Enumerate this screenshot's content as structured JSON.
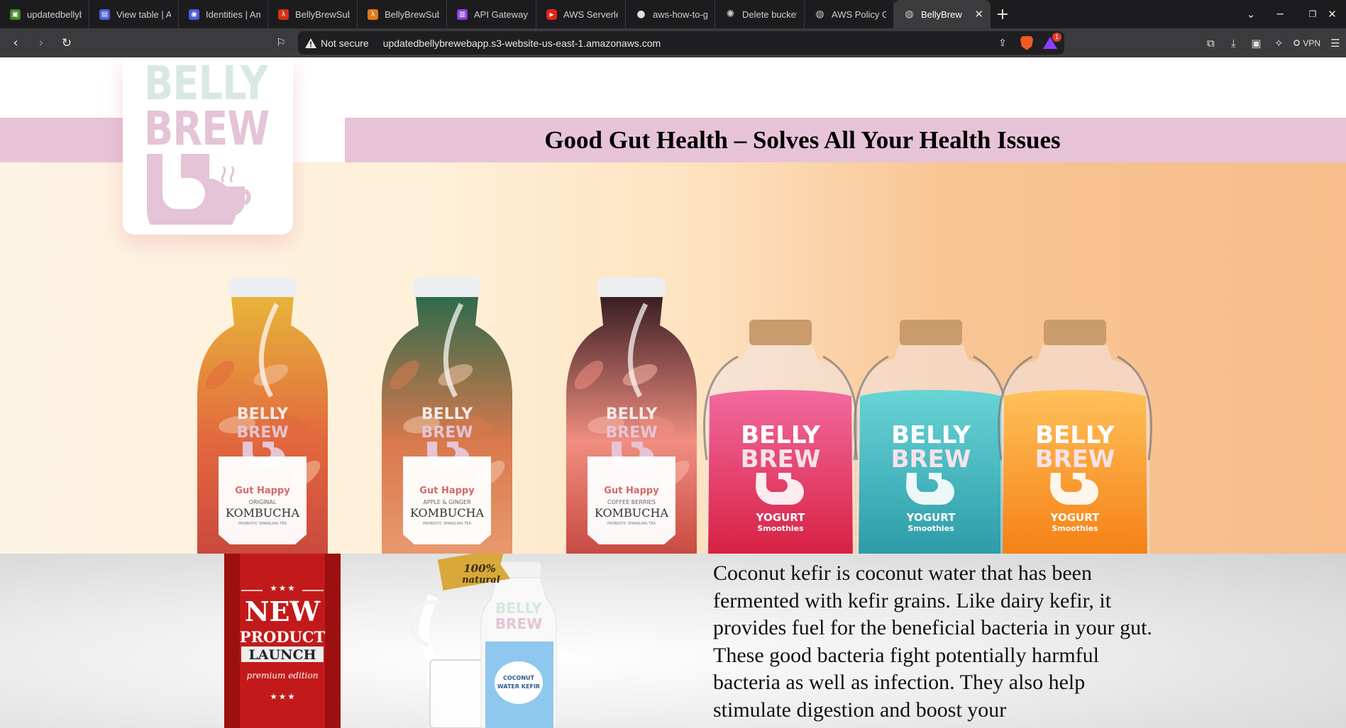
{
  "browser": {
    "tabs": [
      {
        "title": "updatedbellybrewe",
        "icon": "aws-s3-icon",
        "color": "#3f8624"
      },
      {
        "title": "View table | Amazo",
        "icon": "dynamodb-icon",
        "color": "#4d5bdb"
      },
      {
        "title": "Identities | Amazon",
        "icon": "cognito-icon",
        "color": "#4d5bdb"
      },
      {
        "title": "BellyBrewSubmitHa",
        "icon": "lambda-icon",
        "color": "#d13212"
      },
      {
        "title": "BellyBrewSubmitHa",
        "icon": "lambda-icon",
        "color": "#e07b16"
      },
      {
        "title": "API Gateway - API s",
        "icon": "api-gateway-icon",
        "color": "#8b3fd9"
      },
      {
        "title": "AWS Serverless Tut",
        "icon": "youtube-icon",
        "color": "#e62117"
      },
      {
        "title": "aws-how-to-guide/",
        "icon": "github-icon",
        "color": "#e0e0e0"
      },
      {
        "title": "Delete bucket polic",
        "icon": "chatgpt-icon",
        "color": "#cccccc"
      },
      {
        "title": "AWS Policy Generat",
        "icon": "globe-icon",
        "color": "#cccccc"
      },
      {
        "title": "BellyBrew",
        "icon": "globe-icon",
        "color": "#cccccc",
        "active": true
      }
    ],
    "new_tab": "+",
    "security_label": "Not secure",
    "url": "updatedbellybrewebapp.s3-website-us-east-1.amazonaws.com",
    "rewards_badge": "1",
    "vpn_label": "VPN"
  },
  "page": {
    "logo": {
      "line1": "BELLY",
      "line2": "BREW"
    },
    "headline": "Good Gut Health – Solves All Your Health Issues",
    "hero_products": [
      {
        "brand": "BELLY BREW",
        "tag": "Gut Happy",
        "flavor": "ORIGINAL",
        "name": "KOMBUCHA",
        "sub": "PROBIOTIC SPARKLING TEA"
      },
      {
        "brand": "BELLY BREW",
        "tag": "Gut Happy",
        "flavor": "APPLE & GINGER",
        "name": "KOMBUCHA",
        "sub": "PROBIOTIC SPARKLING TEA"
      },
      {
        "brand": "BELLY BREW",
        "tag": "Gut Happy",
        "flavor": "COFFEE BERRIES",
        "name": "KOMBUCHA",
        "sub": "PROBIOTIC SPARKLING TEA"
      },
      {
        "brand1": "BELLY",
        "brand2": "BREW",
        "name": "YOGURT",
        "sub": "Smoothies"
      },
      {
        "brand1": "BELLY",
        "brand2": "BREW",
        "name": "YOGURT",
        "sub": "Smoothies"
      },
      {
        "brand1": "BELLY",
        "brand2": "BREW",
        "name": "YOGURT",
        "sub": "Smoothies"
      }
    ],
    "launch_ribbon": {
      "stars": "★ ★ ★",
      "line1": "NEW",
      "line2": "PRODUCT",
      "line3": "LAUNCH",
      "line4": "premium edition"
    },
    "kefir": {
      "seal1": "100%",
      "seal2": "natural",
      "brand1": "BELLY",
      "brand2": "BREW",
      "label1": "COCONUT",
      "label2": "WATER KEFIR"
    },
    "description": "Coconut kefir is coconut water that has been fermented with kefir grains. Like dairy kefir, it provides fuel for the beneficial bacteria in your gut. These good bacteria fight potentially harmful bacteria as well as infection. They also help stimulate digestion and boost your"
  }
}
